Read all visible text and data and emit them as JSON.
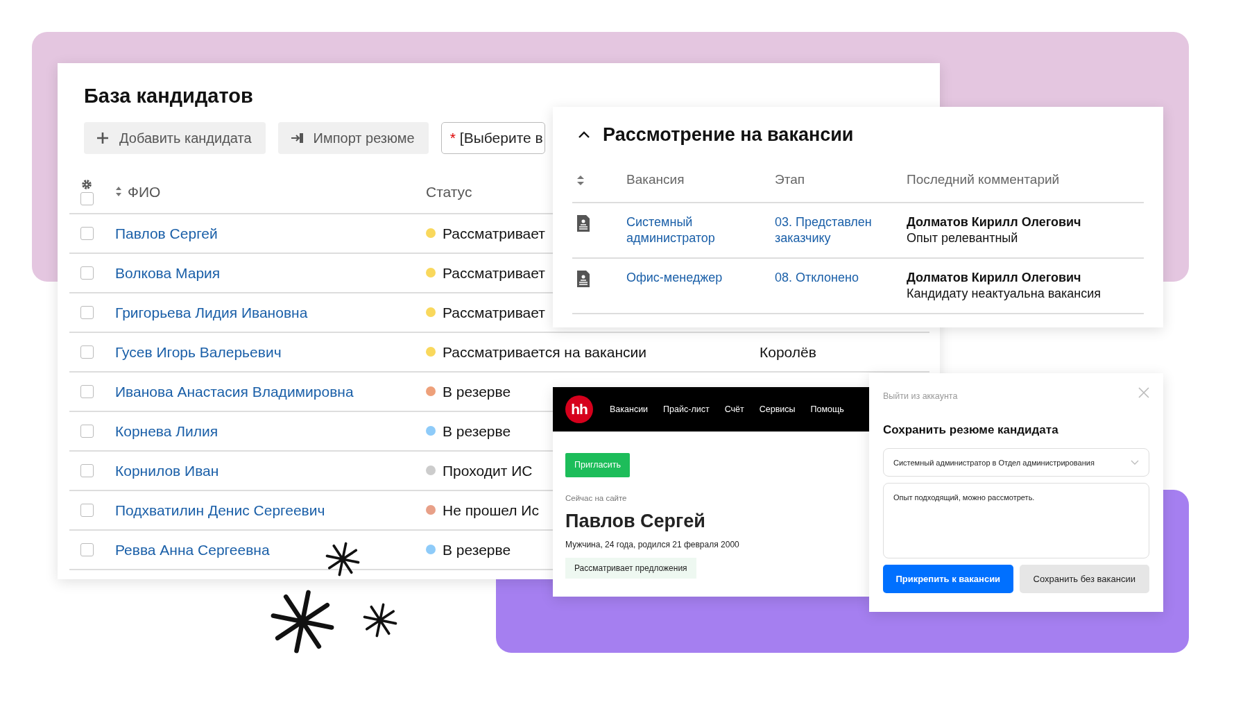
{
  "candidates_card": {
    "title": "База кандидатов",
    "toolbar": [
      {
        "kind": "add",
        "label": "Добавить кандидата"
      },
      {
        "kind": "import",
        "label": "Импорт резюме"
      }
    ],
    "vacancy_select": {
      "required_mark": "*",
      "value": "[Выберите в"
    },
    "header_checkbox": {
      "checked": false
    },
    "columns": [
      {
        "label": "ФИО"
      },
      {
        "label": "Статус"
      }
    ],
    "rows": [
      {
        "checked": false,
        "name": "Павлов Сергей",
        "status": "Рассматривает",
        "color": "#f9d85c"
      },
      {
        "checked": false,
        "name": "Волкова Мария",
        "status": "Рассматривает",
        "color": "#f9d85c"
      },
      {
        "checked": false,
        "name": "Григорьева Лидия Ивановна",
        "status": "Рассматривает",
        "color": "#f9d85c"
      },
      {
        "checked": false,
        "name": "Гусев Игорь Валерьевич",
        "status": "Рассматривается на вакансии",
        "color": "#f9d85c",
        "city": "Королёв"
      },
      {
        "checked": false,
        "name": "Иванова Анастасия Владимировна",
        "status": "В резерве",
        "color": "#eea07a"
      },
      {
        "checked": false,
        "name": "Корнева Лилия",
        "status": "В резерве",
        "color": "#8ecbf9"
      },
      {
        "checked": false,
        "name": "Корнилов Иван",
        "status": "Проходит ИС",
        "color": "#cccccc"
      },
      {
        "checked": false,
        "name": "Подхватилин Денис Сергеевич",
        "status": "Не прошел Ис",
        "color": "#e8a088"
      },
      {
        "checked": false,
        "name": "Ревва Анна Сергеевна",
        "status": "В резерве",
        "color": "#8ecbf9"
      }
    ]
  },
  "vacancy_panel": {
    "title": "Рассмотрение на вакансии",
    "expanded": true,
    "columns": [
      {
        "label": "Вакансия"
      },
      {
        "label": "Этап"
      },
      {
        "label": "Последний комментарий"
      }
    ],
    "rows": [
      {
        "vacancy": "Системный администратор",
        "stage": "03. Представлен заказчику",
        "author": "Долматов Кирилл Олегович",
        "comment": "Опыт релевантный"
      },
      {
        "vacancy": "Офис-менеджер",
        "stage": "08. Отклонено",
        "author": "Долматов Кирилл Олегович",
        "comment": "Кандидату неактуальна вакансия"
      }
    ]
  },
  "hh_page": {
    "logo": "hh",
    "nav": [
      {
        "label": "Вакансии"
      },
      {
        "label": "Прайс-лист"
      },
      {
        "label": "Счёт"
      },
      {
        "label": "Сервисы"
      },
      {
        "label": "Помощь"
      }
    ],
    "invite_button": "Пригласить",
    "online_status": "Сейчас на сайте",
    "name": "Павлов Сергей",
    "details": "Мужчина, 24 года, родился 21 февраля 2000",
    "tag": "Рассматривает предложения"
  },
  "save_dialog": {
    "logout_link": "Выйти из аккаунта",
    "title": "Сохранить резюме кандидата",
    "vacancy_select": {
      "value": "Системный администратор в Отдел администрирования"
    },
    "comment": {
      "value": "Опыт подходящий, можно рассмотреть."
    },
    "buttons": [
      {
        "kind": "primary",
        "label": "Прикрепить к вакансии"
      },
      {
        "kind": "secondary",
        "label": "Сохранить без вакансии"
      }
    ]
  }
}
